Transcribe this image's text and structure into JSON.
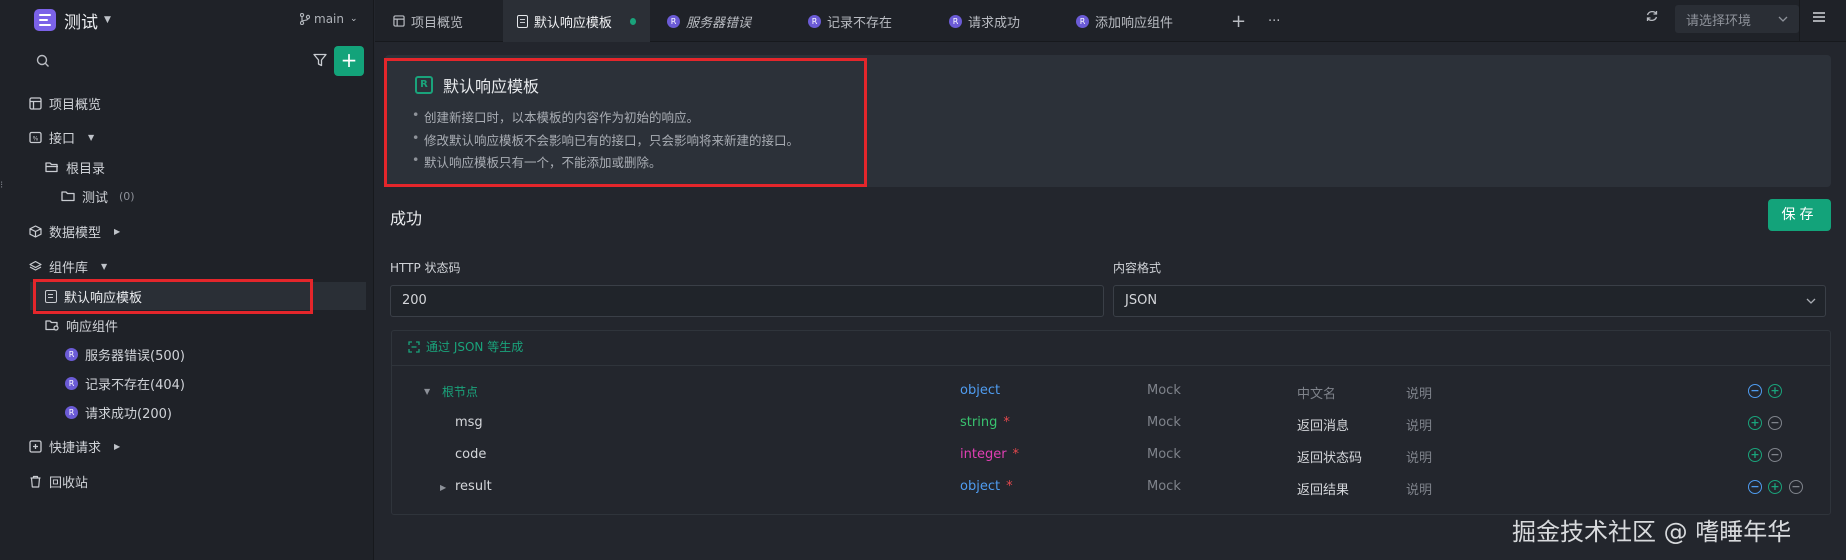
{
  "sidebar": {
    "project_name": "测试",
    "branch": "main",
    "search_placeholder": "",
    "items": [
      {
        "label": "项目概览"
      },
      {
        "label": "接口"
      },
      {
        "label": "根目录"
      },
      {
        "label": "测试",
        "count": "(0)"
      },
      {
        "label": "数据模型"
      },
      {
        "label": "组件库"
      },
      {
        "label": "默认响应模板"
      },
      {
        "label": "响应组件"
      },
      {
        "label": "服务器错误(500)"
      },
      {
        "label": "记录不存在(404)"
      },
      {
        "label": "请求成功(200)"
      },
      {
        "label": "快捷请求"
      },
      {
        "label": "回收站"
      }
    ]
  },
  "tabs": [
    {
      "label": "项目概览"
    },
    {
      "label": "默认响应模板"
    },
    {
      "label": "服务器错误"
    },
    {
      "label": "记录不存在"
    },
    {
      "label": "请求成功"
    },
    {
      "label": "添加响应组件"
    }
  ],
  "tab_actions": {
    "add": "+",
    "more": "···"
  },
  "environment": {
    "placeholder": "请选择环境"
  },
  "notice": {
    "title": "默认响应模板",
    "bullets": [
      "创建新接口时，以本模板的内容作为初始的响应。",
      "修改默认响应模板不会影响已有的接口，只会影响将来新建的接口。",
      "默认响应模板只有一个，不能添加或删除。"
    ]
  },
  "section": {
    "title": "成功",
    "save_label": "保存"
  },
  "fields": {
    "status_label": "HTTP 状态码",
    "status_value": "200",
    "format_label": "内容格式",
    "format_value": "JSON"
  },
  "schema": {
    "generate_label": "通过 JSON 等生成",
    "rows": [
      {
        "name": "根节点",
        "type": "object",
        "required": "",
        "mock": "Mock",
        "cn": "中文名",
        "desc": "说明"
      },
      {
        "name": "msg",
        "type": "string",
        "required": "*",
        "mock": "Mock",
        "cn": "返回消息",
        "desc": "说明"
      },
      {
        "name": "code",
        "type": "integer",
        "required": "*",
        "mock": "Mock",
        "cn": "返回状态码",
        "desc": "说明"
      },
      {
        "name": "result",
        "type": "object",
        "required": "*",
        "mock": "Mock",
        "cn": "返回结果",
        "desc": "说明"
      }
    ]
  },
  "watermark": "掘金技术社区 @ 嗜睡年华",
  "colors": {
    "accent": "#13a37a",
    "highlight": "#e4262b",
    "object": "#4f9cf0",
    "string": "#39c36f",
    "integer": "#e03fb4"
  }
}
